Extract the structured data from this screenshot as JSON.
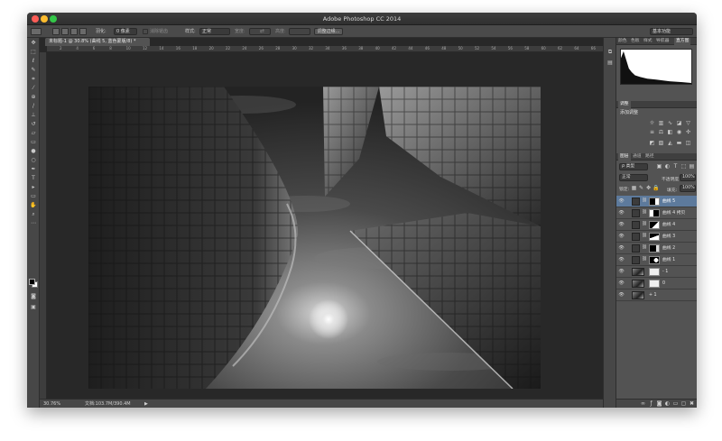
{
  "window": {
    "title": "Adobe Photoshop CC 2014"
  },
  "options_bar": {
    "feather_label": "羽化:",
    "feather_value": "0 像素",
    "antialias_label": "消除锯齿",
    "style_label": "样式:",
    "style_value": "正常",
    "width_label": "宽度:",
    "height_label": "高度:",
    "refine_edge_button": "调整边缘...",
    "workspace_value": "基本功能"
  },
  "document": {
    "tab_title": "未标题-1 @ 30.8% (曲线 5, 蓝色蒙版/8) *",
    "ruler_ticks": [
      "2",
      "4",
      "6",
      "8",
      "10",
      "12",
      "14",
      "16",
      "18",
      "20",
      "22",
      "24",
      "26",
      "28",
      "30",
      "32",
      "34",
      "36",
      "38",
      "40",
      "42",
      "44",
      "46",
      "48",
      "50",
      "52",
      "54",
      "56",
      "58",
      "60",
      "62",
      "64",
      "66"
    ]
  },
  "status_bar": {
    "zoom": "30.76%",
    "doc_info": "文档:103.7M/390.4M"
  },
  "panels": {
    "top_tabs": [
      "颜色",
      "色板",
      "样式",
      "导航器",
      "直方图"
    ],
    "top_active": "直方图",
    "adjust_tab": "调整",
    "adjust_title": "添加调整",
    "layer_tabs": [
      "图层",
      "通道",
      "路径"
    ],
    "layer_kind": "ρ 类型",
    "blend_mode": "正常",
    "opacity_label": "不透明度:",
    "opacity_value": "100%",
    "lock_label": "锁定:",
    "fill_label": "填充:",
    "fill_value": "100%",
    "layers": [
      {
        "name": "曲线 5",
        "type": "adjustment",
        "selected": true
      },
      {
        "name": "曲线 4 拷贝",
        "type": "adjustment",
        "selected": false
      },
      {
        "name": "曲线 4",
        "type": "adjustment",
        "selected": false
      },
      {
        "name": "曲线 3",
        "type": "adjustment",
        "selected": false
      },
      {
        "name": "曲线 2",
        "type": "adjustment",
        "selected": false
      },
      {
        "name": "曲线 1",
        "type": "adjustment",
        "selected": false
      },
      {
        "name": "- 1",
        "type": "pixel",
        "selected": false
      },
      {
        "name": "0",
        "type": "pixel",
        "selected": false
      },
      {
        "name": "+ 1",
        "type": "pixel",
        "selected": false
      }
    ]
  },
  "colors": {
    "selected_layer": "#5d7a9c",
    "chrome": "#535353",
    "canvas_surround": "#282828"
  }
}
